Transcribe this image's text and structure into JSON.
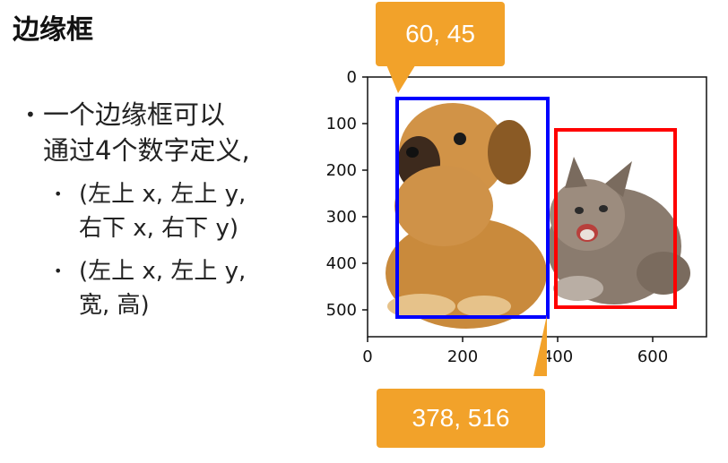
{
  "title": "边缘框",
  "bullets": {
    "main_line1": "一个边缘框可以",
    "main_line2": "通过4个数字定义,",
    "sub1_line1": "(左上 x, 左上 y,",
    "sub1_line2": "右下 x, 右下 y)",
    "sub2_line1": "(左上 x, 左上 y,",
    "sub2_line2": "宽, 高)"
  },
  "callouts": {
    "top_left_coord": "60, 45",
    "bottom_right_coord": "378, 516"
  },
  "image_plot": {
    "x_ticks": [
      "0",
      "200",
      "400",
      "600"
    ],
    "y_ticks": [
      "0",
      "100",
      "200",
      "300",
      "400",
      "500"
    ],
    "boxes": [
      {
        "name": "dog",
        "color": "#0000ff",
        "x1": 60,
        "y1": 45,
        "x2": 378,
        "y2": 516
      },
      {
        "name": "cat",
        "color": "#ff0000",
        "x1": 400,
        "y1": 112,
        "x2": 655,
        "y2": 493
      }
    ],
    "colors": {
      "dog_fur": "#c98a3c",
      "cat_fur": "#8a7b6e",
      "callout": "#f2a22a"
    }
  }
}
